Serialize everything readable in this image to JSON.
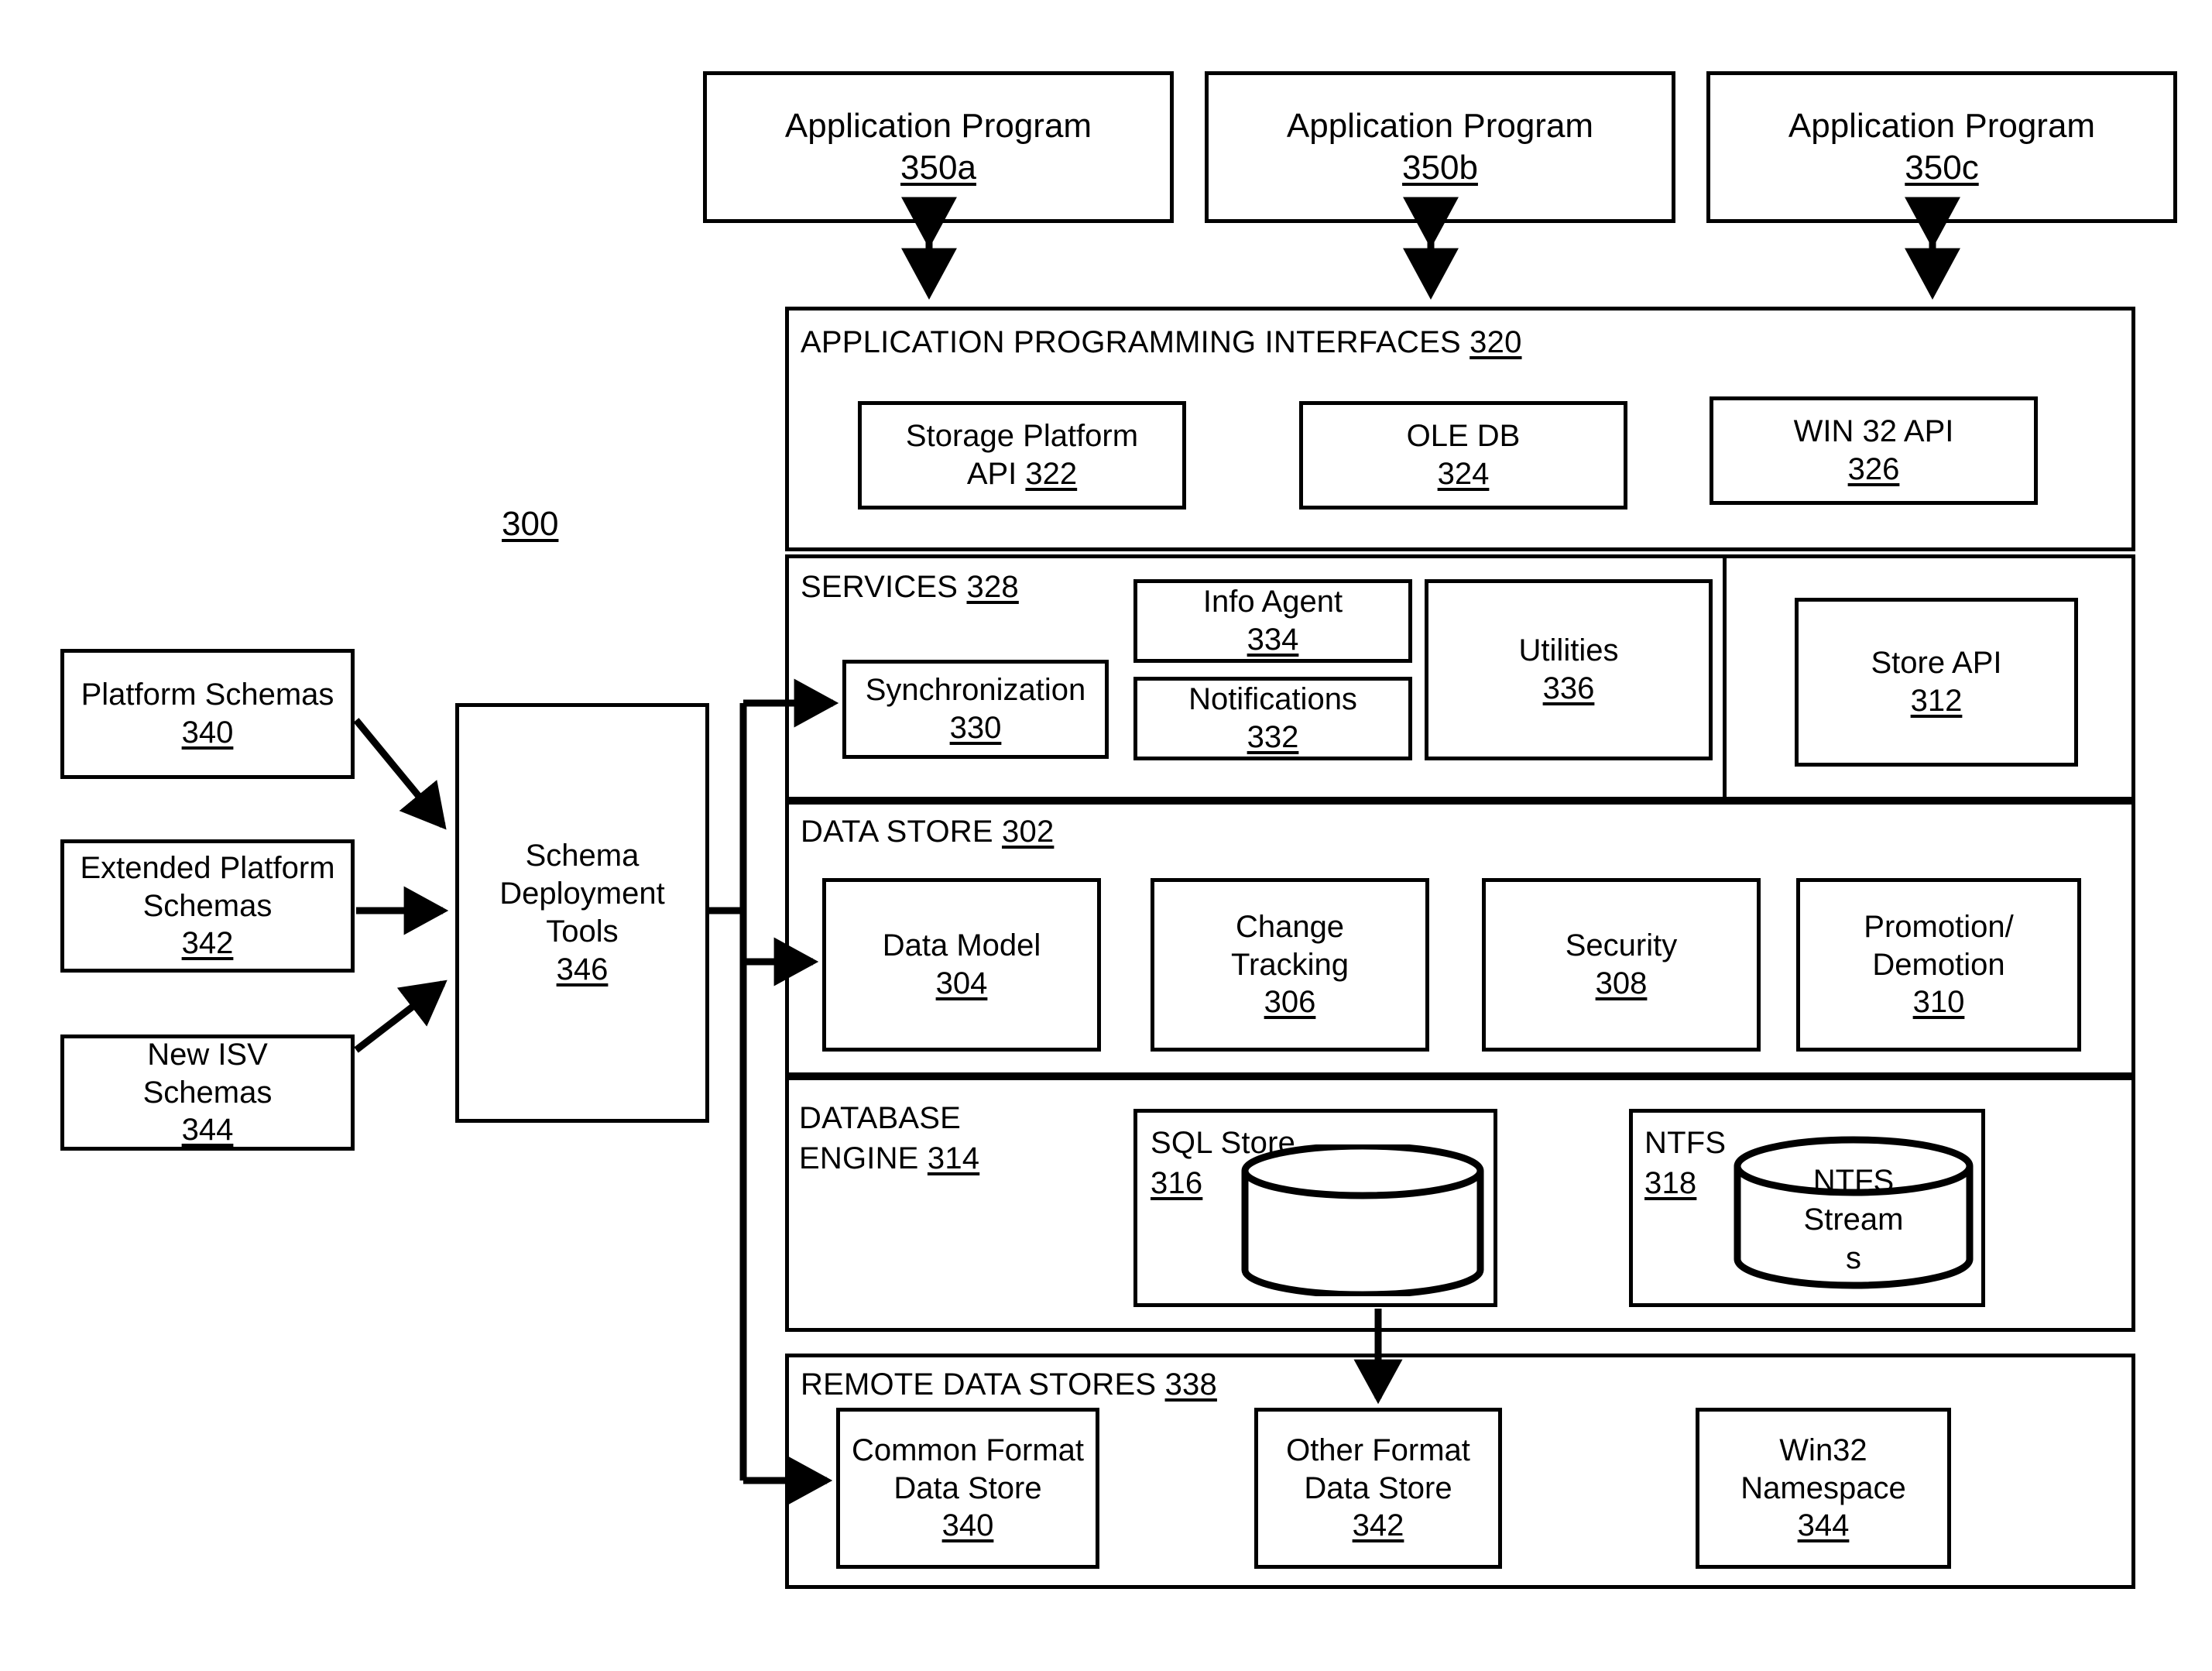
{
  "figure": {
    "reference_numeral": "300"
  },
  "app_programs": [
    {
      "label": "Application Program",
      "num": "350a"
    },
    {
      "label": "Application Program",
      "num": "350b"
    },
    {
      "label": "Application Program",
      "num": "350c"
    }
  ],
  "schemas": [
    {
      "line1": "Platform Schemas",
      "line2": "",
      "num": "340"
    },
    {
      "line1": "Extended Platform",
      "line2": "Schemas",
      "num": "342"
    },
    {
      "line1": "New ISV",
      "line2": "Schemas",
      "num": "344"
    }
  ],
  "deployment_tools": {
    "line1": "Schema",
    "line2": "Deployment",
    "line3": "Tools",
    "num": "346"
  },
  "api_layer": {
    "title": "APPLICATION PROGRAMMING INTERFACES",
    "title_num": "320",
    "items": [
      {
        "line1": "Storage Platform",
        "line2": "API",
        "num": "322",
        "inline_num": true
      },
      {
        "line1": "OLE DB",
        "line2": "",
        "num": "324",
        "inline_num": false
      },
      {
        "line1": "WIN 32 API",
        "line2": "",
        "num": "326",
        "inline_num": false
      }
    ]
  },
  "services_layer": {
    "title": "SERVICES",
    "title_num": "328",
    "synchronization": {
      "label": "Synchronization",
      "num": "330"
    },
    "info_agent": {
      "label": "Info Agent",
      "num": "334"
    },
    "notifications": {
      "label": "Notifications",
      "num": "332"
    },
    "utilities": {
      "label": "Utilities",
      "num": "336"
    },
    "store_api": {
      "label": "Store API",
      "num": "312"
    }
  },
  "data_store_layer": {
    "title": "DATA STORE",
    "title_num": "302",
    "items": [
      {
        "line1": "Data Model",
        "line2": "",
        "num": "304"
      },
      {
        "line1": "Change",
        "line2": "Tracking",
        "num": "306"
      },
      {
        "line1": "Security",
        "line2": "",
        "num": "308"
      },
      {
        "line1": "Promotion/",
        "line2": "Demotion",
        "num": "310"
      }
    ]
  },
  "database_engine_layer": {
    "title_line1": "DATABASE",
    "title_line2": "ENGINE",
    "title_num": "314",
    "sql_store": {
      "label": "SQL Store",
      "num": "316",
      "cylinder_text": ""
    },
    "ntfs": {
      "label": "NTFS",
      "num": "318",
      "cylinder_line1": "NTFS",
      "cylinder_line2": "Stream",
      "cylinder_line3": "s"
    }
  },
  "remote_data_stores_layer": {
    "title": "REMOTE DATA STORES",
    "title_num": "338",
    "items": [
      {
        "line1": "Common Format",
        "line2": "Data Store",
        "num": "340"
      },
      {
        "line1": "Other Format",
        "line2": "Data Store",
        "num": "342"
      },
      {
        "line1": "Win32",
        "line2": "Namespace",
        "num": "344"
      }
    ]
  },
  "colors": {
    "stroke": "#000000",
    "background": "#ffffff"
  }
}
